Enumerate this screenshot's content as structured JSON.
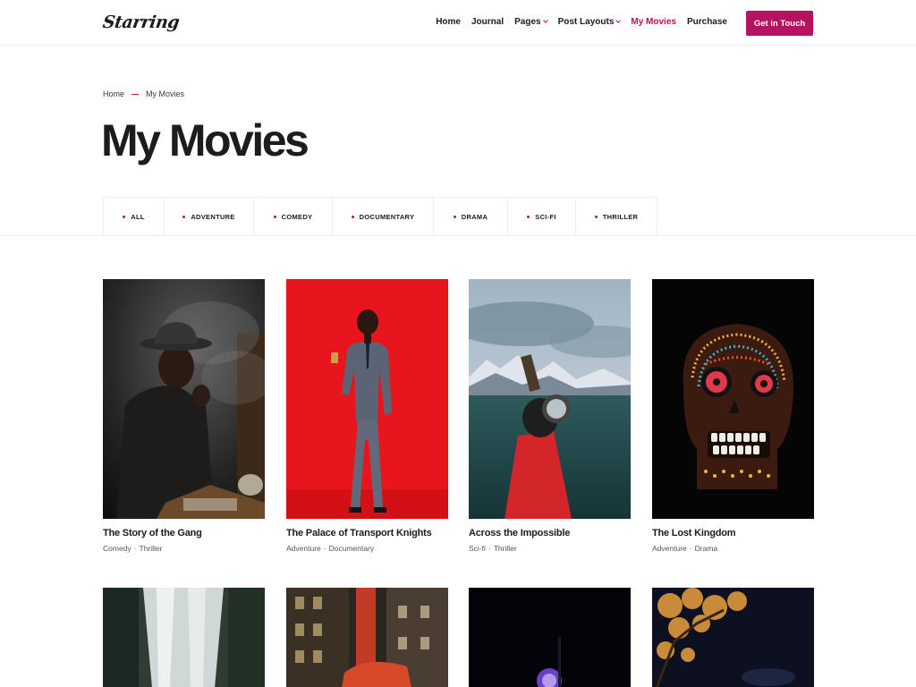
{
  "header": {
    "logo": "Starring",
    "nav": [
      {
        "label": "Home",
        "dropdown": false,
        "active": false
      },
      {
        "label": "Journal",
        "dropdown": false,
        "active": false
      },
      {
        "label": "Pages",
        "dropdown": true,
        "active": false
      },
      {
        "label": "Post Layouts",
        "dropdown": true,
        "active": false
      },
      {
        "label": "My Movies",
        "dropdown": false,
        "active": true
      },
      {
        "label": "Purchase",
        "dropdown": false,
        "active": false
      }
    ],
    "cta_label": "Get in Touch"
  },
  "breadcrumb": {
    "home": "Home",
    "current": "My Movies"
  },
  "page_title": "My Movies",
  "filters": [
    "ALL",
    "ADVENTURE",
    "COMEDY",
    "DOCUMENTARY",
    "DRAMA",
    "SCI-FI",
    "THRILLER"
  ],
  "movies": [
    {
      "title": "The Story of the Gang",
      "genres": [
        "Comedy",
        "Thriller"
      ]
    },
    {
      "title": "The Palace of Transport Knights",
      "genres": [
        "Adventure",
        "Documentary"
      ]
    },
    {
      "title": "Across the Impossible",
      "genres": [
        "Sci-fi",
        "Thriller"
      ]
    },
    {
      "title": "The Lost Kingdom",
      "genres": [
        "Adventure",
        "Drama"
      ]
    }
  ],
  "colors": {
    "accent": "#b5125f",
    "text": "#1c1c1e",
    "border": "#eeeeee"
  }
}
